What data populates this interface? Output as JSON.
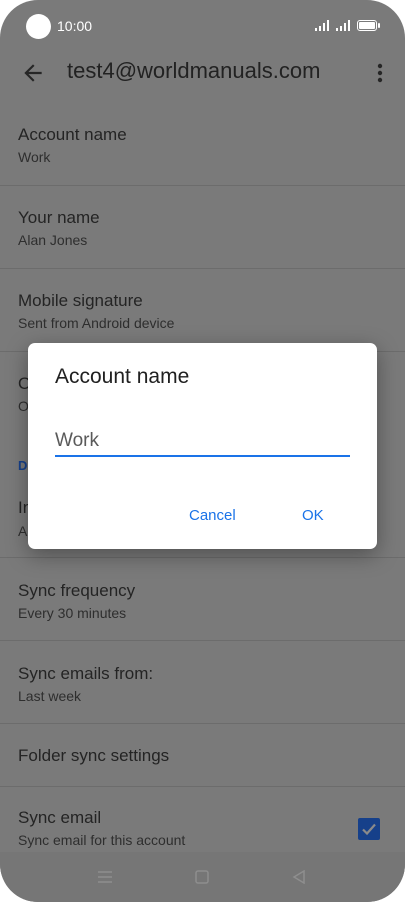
{
  "status_bar": {
    "time": "10:00"
  },
  "header": {
    "title": "test4@worldmanuals.com",
    "back_icon": "arrow-left-icon",
    "menu_icon": "more-vert-icon"
  },
  "settings": {
    "account_name": {
      "title": "Account name",
      "value": "Work"
    },
    "your_name": {
      "title": "Your name",
      "value": "Alan Jones"
    },
    "mobile_signature": {
      "title": "Mobile signature",
      "value": "Sent from Android device"
    },
    "hidden_row_1": {
      "title_fragment": "O",
      "value_fragment": "O"
    },
    "section_header_fragment": "D",
    "hidden_row_2": {
      "title_fragment": "In",
      "value_fragment": "A"
    },
    "sync_frequency": {
      "title": "Sync frequency",
      "value": "Every 30 minutes"
    },
    "sync_emails_from": {
      "title": "Sync emails from:",
      "value": "Last week"
    },
    "folder_sync": {
      "title": "Folder sync settings"
    },
    "sync_email": {
      "title": "Sync email",
      "value": "Sync email for this account",
      "checked": true
    }
  },
  "dialog": {
    "title": "Account name",
    "input_value": "Work",
    "cancel_label": "Cancel",
    "ok_label": "OK"
  },
  "colors": {
    "accent": "#1a73e8",
    "scrim": "#7a7a7a",
    "checkbox": "#16408a"
  }
}
